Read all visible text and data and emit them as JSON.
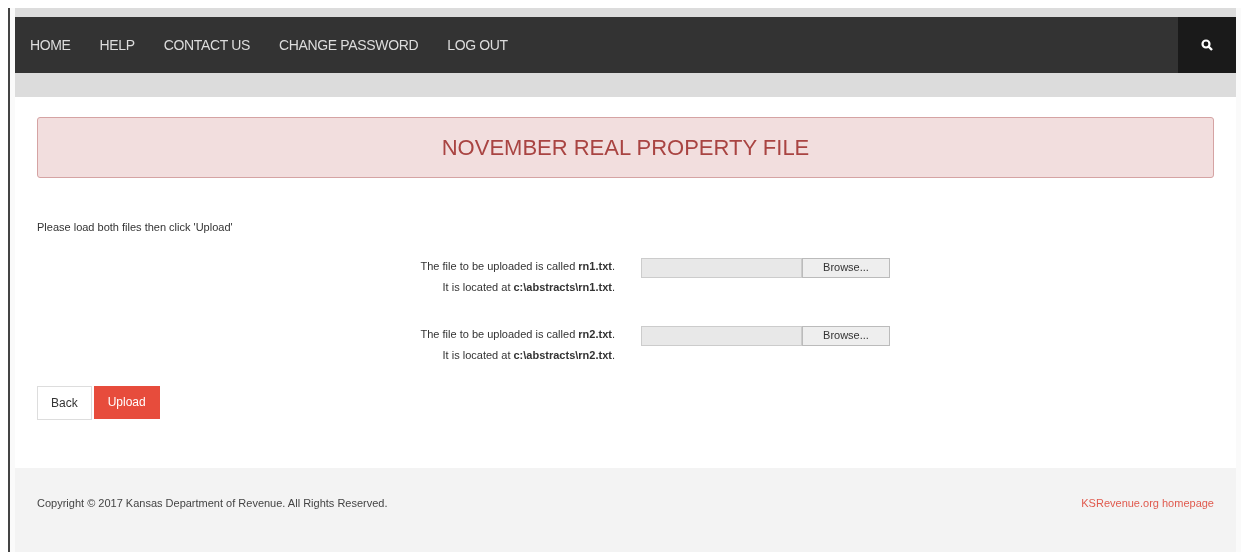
{
  "nav": {
    "items": [
      "HOME",
      "HELP",
      "CONTACT US",
      "CHANGE PASSWORD",
      "LOG OUT"
    ]
  },
  "banner": {
    "title": "NOVEMBER REAL PROPERTY FILE"
  },
  "instruction": "Please load both files then click 'Upload'",
  "files": [
    {
      "name_text": "The file to be uploaded is called **rn1.txt**.",
      "location_text": "It is located at **c:\\abstracts\\rn1.txt**.",
      "button": "Browse..."
    },
    {
      "name_text": "The file to be uploaded is called **rn2.txt**.",
      "location_text": "It is located at **c:\\abstracts\\rn2.txt**.",
      "button": "Browse..."
    }
  ],
  "buttons": [
    {
      "label": "Back",
      "kind": "default"
    },
    {
      "label": "Upload",
      "kind": "primary"
    }
  ],
  "footer": {
    "copyright": "Copyright © 2017 Kansas Department of Revenue. All Rights Reserved.",
    "link": "KSRevenue.org homepage"
  }
}
